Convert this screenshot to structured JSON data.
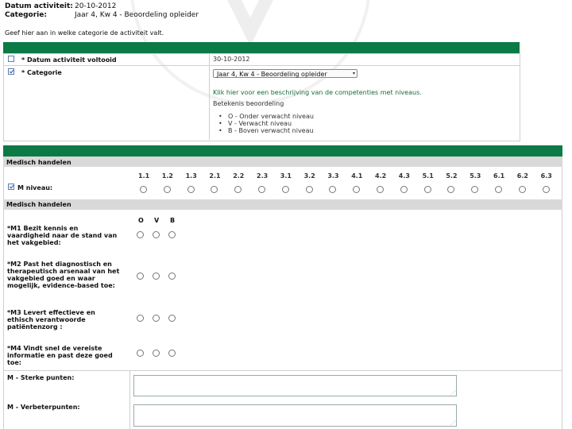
{
  "header": {
    "date_label": "Datum activiteit:",
    "date_value": "20-10-2012",
    "category_label": "Categorie:",
    "category_value": "Jaar 4, Kw 4 - Beoordeling opleider"
  },
  "intro_text": "Geef hier aan in welke categorie de activiteit valt.",
  "form1": {
    "date_completed_label": "* Datum activiteit voltooid",
    "date_completed_value": "30-10-2012",
    "category_label": "* Categorie",
    "category_select_value": "Jaar 4, Kw 4 - Beoordeling opleider",
    "link_text": "Klik hier voor een beschrijving van de competenties met niveaus.",
    "legend_title": "Betekenis beoordeling",
    "legend_items": [
      "O  -  Onder verwacht niveau",
      "V  -  Verwacht niveau",
      "B  -  Boven verwacht niveau"
    ]
  },
  "section": {
    "title": "Medisch handelen",
    "level_codes": [
      "1.1",
      "1.2",
      "1.3",
      "2.1",
      "2.2",
      "2.3",
      "3.1",
      "3.2",
      "3.3",
      "4.1",
      "4.2",
      "4.3",
      "5.1",
      "5.2",
      "5.3",
      "6.1",
      "6.2",
      "6.3"
    ],
    "level_label": "M niveau:",
    "subsection_title": "Medisch handelen",
    "ovb_headers": [
      "O",
      "V",
      "B"
    ],
    "questions": [
      "*M1 Bezit kennis en vaardigheid naar de stand van het vakgebied:",
      "*M2 Past het diagnostisch en therapeutisch arsenaal van het vakgebied goed en waar mogelijk, evidence-based toe:",
      "*M3 Levert effectieve en ethisch verantwoorde patiëntenzorg :",
      "*M4 Vindt snel de vereiste informatie en past deze goed toe:"
    ],
    "strengths_label": "M - Sterke punten:",
    "improvements_label": "M - Verbeterpunten:"
  },
  "colors": {
    "header_green": "#0b7a45",
    "section_grey": "#d9d9d9",
    "link_green": "#1a6a3a"
  }
}
